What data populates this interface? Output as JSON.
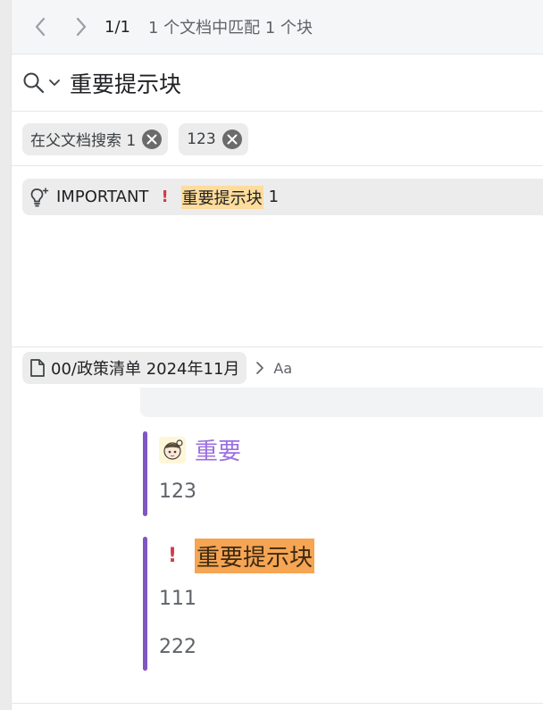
{
  "toolbar": {
    "page_counter": "1/1",
    "match_summary": "1 个文档中匹配 1 个块"
  },
  "search": {
    "query": "重要提示块"
  },
  "filters": [
    {
      "label": "在父文档搜索 1"
    },
    {
      "label": "123"
    }
  ],
  "result": {
    "label": "IMPORTANT",
    "bang": "!",
    "highlight": "重要提示块",
    "count": "1"
  },
  "preview": {
    "doc_title": "00/政策清单 2024年11月",
    "aa_label": "Aa",
    "callouts": [
      {
        "title": "重要",
        "lines": [
          "123"
        ],
        "emoji": "anime-girl-emoji"
      },
      {
        "title": "重要提示块",
        "lines": [
          "111",
          "222"
        ],
        "icon": "!"
      }
    ]
  },
  "colors": {
    "accent_bar": "#7e57c2",
    "highlight_soft": "#fddc9c",
    "highlight_strong": "#f5a553",
    "alert_red": "#d13b4c",
    "callout_title_purple": "#9b6fe0"
  }
}
